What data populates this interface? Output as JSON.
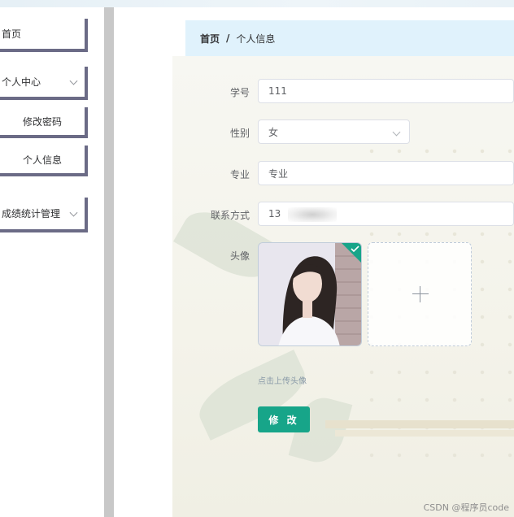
{
  "sidebar": {
    "items": [
      {
        "label": "首页"
      },
      {
        "label": "个人中心",
        "children": [
          {
            "label": "修改密码"
          },
          {
            "label": "个人信息"
          }
        ]
      },
      {
        "label": "成绩统计管理"
      }
    ]
  },
  "breadcrumb": {
    "home": "首页",
    "separator": "/",
    "current": "个人信息"
  },
  "form": {
    "student_id": {
      "label": "学号",
      "value": "111"
    },
    "gender": {
      "label": "性别",
      "value": "女"
    },
    "major": {
      "label": "专业",
      "value": "专业"
    },
    "phone": {
      "label": "联系方式",
      "value": "13"
    },
    "avatar": {
      "label": "头像",
      "upload_hint": "点击上传头像"
    }
  },
  "actions": {
    "submit_label": "修 改"
  },
  "colors": {
    "primary": "#17a589",
    "breadcrumb_bg": "#e0f2fc",
    "sidebar_border": "#6b6b86"
  },
  "watermark": "CSDN @程序员code"
}
